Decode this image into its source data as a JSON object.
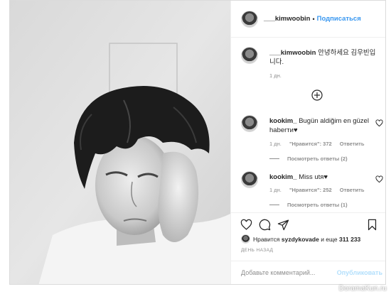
{
  "post": {
    "username": "___kimwoobin",
    "separator": "•",
    "follow_label": "Подписаться",
    "caption": "안녕하세요 김우빈입니다.",
    "caption_time": "1 дн."
  },
  "comments": [
    {
      "username": "kookim_",
      "text": "Bugün aldiğim en güzel haberти",
      "time": "1 дн.",
      "likes": "\"Нравится\": 372",
      "reply_label": "Ответить",
      "view_replies": "Посмотреть ответы (2)"
    },
    {
      "username": "kookim_",
      "text": "Miss utя",
      "time": "1 дн.",
      "likes": "\"Нравится\": 252",
      "reply_label": "Ответить",
      "view_replies": "Посмотреть ответы (1)"
    }
  ],
  "likes": {
    "prefix": "Нравится",
    "user": "syzdykovade",
    "and_more": "и еще",
    "count": "311 233"
  },
  "time_ago": "ДЕНЬ НАЗАД",
  "comment_input": {
    "placeholder": "Добавьте комментарий...",
    "publish_label": "Опубликовать"
  },
  "watermark": "DoramaKun.ru",
  "icons": {
    "like": "heart-icon",
    "comment": "comment-icon",
    "share": "share-icon",
    "save": "bookmark-icon",
    "load_more": "plus-circle-icon"
  },
  "colors": {
    "link_blue": "#3897f0",
    "publish_disabled": "#b2dffc",
    "muted": "#8e8e8e",
    "border": "#dbdbdb"
  }
}
